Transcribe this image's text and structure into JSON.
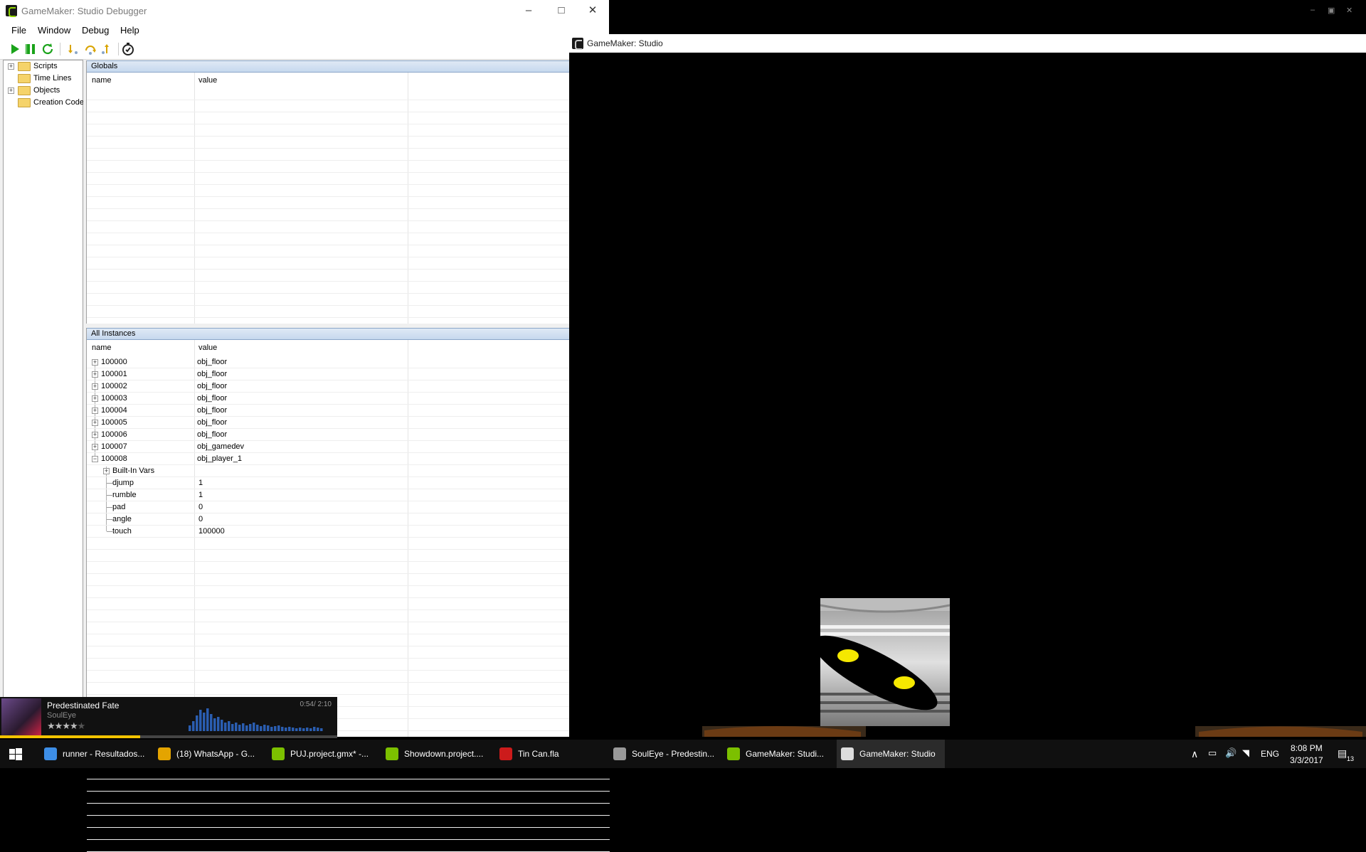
{
  "debugger": {
    "title": "GameMaker: Studio Debugger",
    "menu": [
      "File",
      "Window",
      "Debug",
      "Help"
    ],
    "tree": [
      "Scripts",
      "Time Lines",
      "Objects",
      "Creation Code"
    ],
    "globals": {
      "header": "Globals",
      "col_name": "name",
      "col_value": "value"
    },
    "instances": {
      "header": "All Instances",
      "col_name": "name",
      "col_value": "value",
      "rows": [
        {
          "name": "100000",
          "value": "obj_floor"
        },
        {
          "name": "100001",
          "value": "obj_floor"
        },
        {
          "name": "100002",
          "value": "obj_floor"
        },
        {
          "name": "100003",
          "value": "obj_floor"
        },
        {
          "name": "100004",
          "value": "obj_floor"
        },
        {
          "name": "100005",
          "value": "obj_floor"
        },
        {
          "name": "100006",
          "value": "obj_floor"
        },
        {
          "name": "100007",
          "value": "obj_gamedev"
        },
        {
          "name": "100008",
          "value": "obj_player_1"
        }
      ],
      "children": [
        {
          "name": "Built-In Vars",
          "value": ""
        },
        {
          "name": "djump",
          "value": "1"
        },
        {
          "name": "rumble",
          "value": "1"
        },
        {
          "name": "pad",
          "value": "0"
        },
        {
          "name": "angle",
          "value": "0"
        },
        {
          "name": "touch",
          "value": "100000"
        }
      ]
    }
  },
  "music": {
    "track": "Predestinated Fate",
    "artist": "SoulEye",
    "time": "0:54/ 2:10",
    "progress": 0.415,
    "rating": 4
  },
  "game": {
    "title": "GameMaker: Studio",
    "eye_color": "#f5e800"
  },
  "taskbar": {
    "items": [
      {
        "label": "runner - Resultados...",
        "icon": "file-explorer-icon",
        "color": "#3d8ee6"
      },
      {
        "label": "(18) WhatsApp - G...",
        "icon": "chrome-icon",
        "color": "#e4a400"
      },
      {
        "label": "PUJ.project.gmx* -...",
        "icon": "gamemaker-icon",
        "color": "#7cc000"
      },
      {
        "label": "Showdown.project....",
        "icon": "gamemaker-icon",
        "color": "#7cc000"
      },
      {
        "label": "Tin Can.fla",
        "icon": "flash-icon",
        "color": "#cc1b1b"
      },
      {
        "label": "SoulEye - Predestin...",
        "icon": "media-player-icon",
        "color": "#999999"
      },
      {
        "label": "GameMaker: Studi...",
        "icon": "gamemaker-icon",
        "color": "#7cc000"
      },
      {
        "label": "GameMaker: Studio",
        "icon": "gamemaker-icon",
        "color": "#dddddd"
      }
    ],
    "tray": {
      "language": "ENG",
      "time": "8:08 PM",
      "date": "3/3/2017",
      "notifications": "13"
    }
  }
}
